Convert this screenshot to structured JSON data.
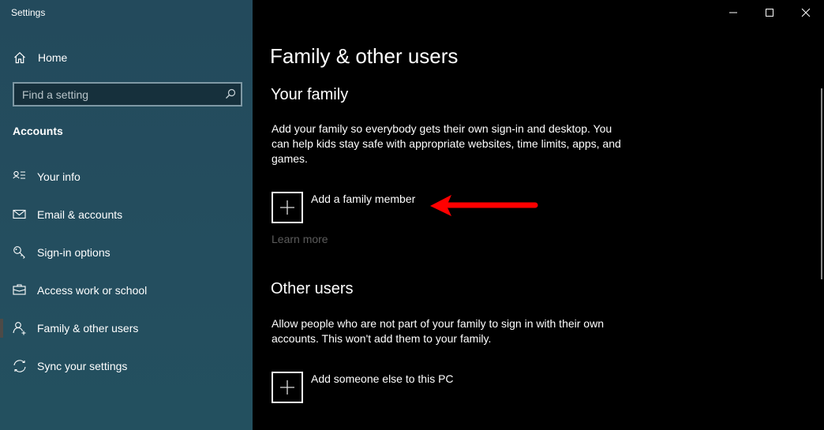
{
  "window": {
    "title": "Settings",
    "controls": {
      "minimize": "minimize-icon",
      "maximize": "maximize-icon",
      "close": "close-icon"
    }
  },
  "sidebar": {
    "home_label": "Home",
    "search_placeholder": "Find a setting",
    "search_value": "",
    "section_title": "Accounts",
    "items": [
      {
        "label": "Your info",
        "icon": "contact-card-icon",
        "selected": false
      },
      {
        "label": "Email & accounts",
        "icon": "mail-icon",
        "selected": false
      },
      {
        "label": "Sign-in options",
        "icon": "key-icon",
        "selected": false
      },
      {
        "label": "Access work or school",
        "icon": "briefcase-icon",
        "selected": false
      },
      {
        "label": "Family & other users",
        "icon": "add-person-icon",
        "selected": true
      },
      {
        "label": "Sync your settings",
        "icon": "sync-icon",
        "selected": false
      }
    ]
  },
  "main": {
    "title": "Family & other users",
    "your_family": {
      "heading": "Your family",
      "description": "Add your family so everybody gets their own sign-in and desktop. You can help kids stay safe with appropriate websites, time limits, apps, and games.",
      "add_label": "Add a family member",
      "learn_more": "Learn more"
    },
    "other_users": {
      "heading": "Other users",
      "description": "Allow people who are not part of your family to sign in with their own accounts. This won't add them to your family.",
      "add_label": "Add someone else to this PC"
    },
    "annotation": {
      "type": "arrow",
      "color": "#ff0000",
      "points_to": "Add a family member"
    }
  }
}
